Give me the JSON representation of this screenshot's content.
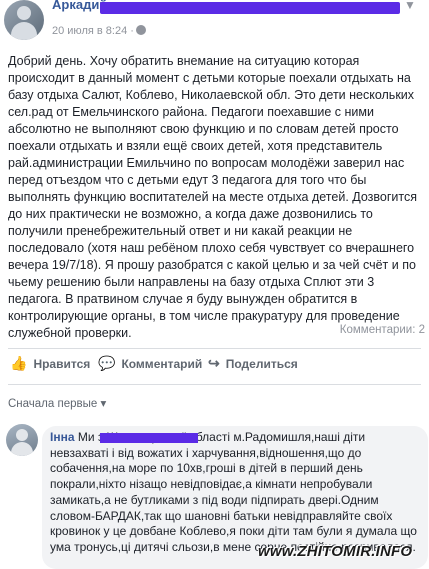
{
  "post": {
    "author": "Аркадий",
    "date": "20 июля в 8:24 ·",
    "text": "Добрий день. Хочу обратить внемание на ситуацию которая происходит в данный момент с детьми которые поехали отдыхать на базу отдыха Салют, Коблево, Николаевской обл. Это дети нескольких сел.рад от Емельчинского района. Педагоги поехавшие с ними абсолютно не выполняют свою функцию и по словам детей просто поехали отдыхать и взяли ещё своих детей, хотя представитель рай.администрации Емильчино по вопросам молодёжи заверил нас перед отъездом что с детьми едут 3 педагога для того что бы выполнять функцию воспитателей на месте отдыха детей. Дозвогится до них практически не возможно, а когда даже дозвонились то получили пренебрежительный ответ и ни какай реакции не последовало (хотя наш ребёном плохо себя чувствует со вчерашнего вечера 19/7/18). Я прошу разобратся с какой целью и за чей счёт и по чьему решению были направлены на базу отдыха Сплют эти 3 педагога. В пратвином случае я буду вынужден обратится в контролирующие органы, в том числе пракуратуру для проведение служебной проверки.",
    "comments_count": "Комментарии: 2"
  },
  "actions": {
    "like": "Нравится",
    "comment": "Комментарий",
    "share": "Поделиться"
  },
  "sort_label": "Сначала первые ▾",
  "comment": {
    "author": "Інна",
    "text": "Ми з Житомирської області м.Радомишля,наші діти невзахваті і від вожатих і харчування,відношення,що до собачення,на море по 10хв,гроші в дітей в перший день покрали,ніхто нізащо невідповідає,а кімнати непробували замикать,а не бутликами з під води підпирать двері.Одним словом-БАРДАК,так що шановні батьки невідправляйте своїх кровинок у це довбане Коблево,я поки діти там були я думала що ума тронусь,ці дитячі сльози,в мене серце постійно розривалося."
  },
  "watermark": "www.ZHITOMIR.INFO",
  "colors": {
    "link": "#365899",
    "redaction": "#5b2be6",
    "muted": "#90949c"
  }
}
